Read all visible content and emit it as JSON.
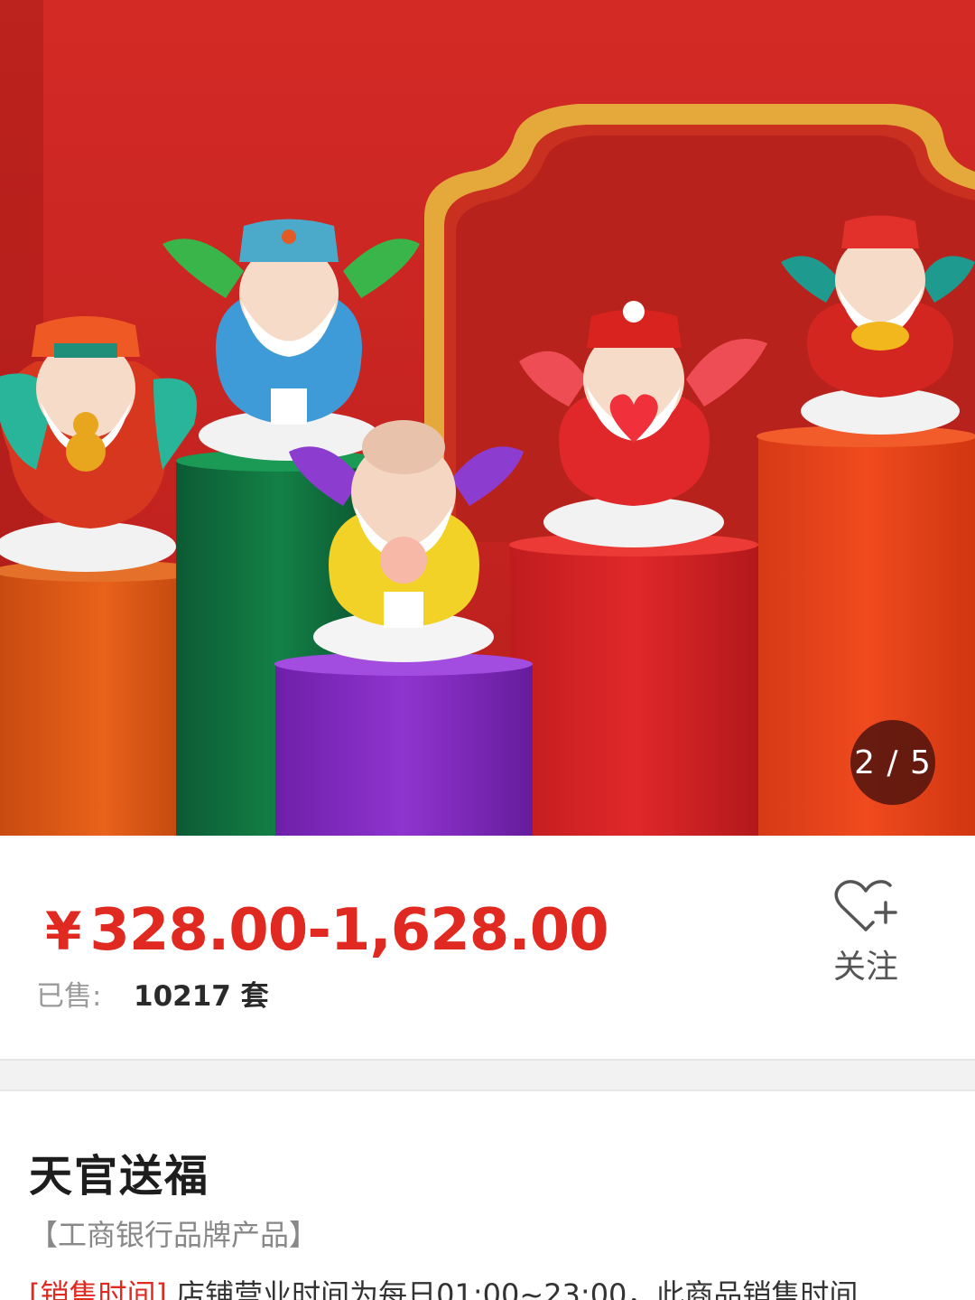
{
  "gallery": {
    "current": "2",
    "total": "5",
    "indicator": "2 / 5",
    "image_icon": "product-photo"
  },
  "product": {
    "currency": "¥",
    "price_range": "328.00-1,628.00",
    "sold_label": "已售:",
    "sold_value": "10217 套",
    "follow_label": "关注",
    "follow_icon": "heart-plus-icon",
    "title": "天官送福",
    "brand_tag": "【工商银行品牌产品】",
    "sales_tag": "[销售时间]",
    "sales_text": "店铺营业时间为每日01:00~23:00，此商品销售时间"
  },
  "colors": {
    "price": "#e02a21",
    "accent_red": "#c9231f",
    "text_dark": "#1d1d1d",
    "text_muted": "#888888"
  }
}
